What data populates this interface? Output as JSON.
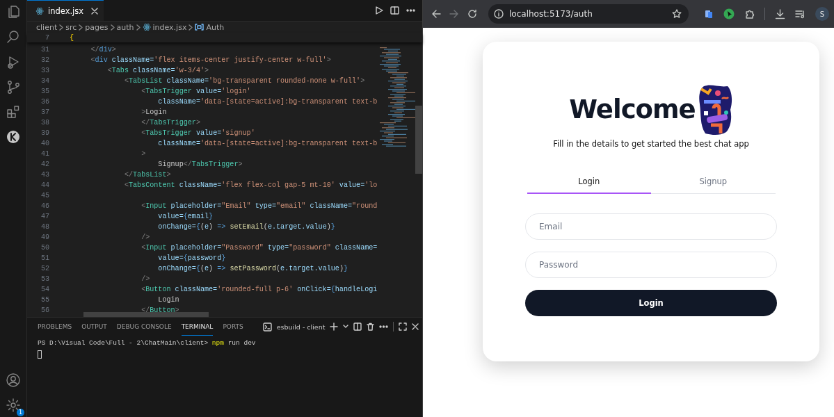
{
  "editor": {
    "settings_badge": "1",
    "tab": {
      "label": "index.jsx",
      "selected": true
    },
    "breadcrumb": [
      {
        "kind": "folder",
        "label": "client"
      },
      {
        "kind": "folder",
        "label": "src"
      },
      {
        "kind": "folder",
        "label": "pages"
      },
      {
        "kind": "folder",
        "label": "auth"
      },
      {
        "kind": "file",
        "label": "index.jsx"
      },
      {
        "kind": "symbol",
        "label": "Auth"
      }
    ],
    "sticky_line": {
      "number": "7",
      "segments": [
        {
          "kind": "bracket",
          "text": "{"
        }
      ]
    },
    "lines": [
      {
        "number": "31",
        "segments": [
          {
            "kind": "punct",
            "text": "        </"
          },
          {
            "kind": "htag",
            "text": "div"
          },
          {
            "kind": "punct",
            "text": ">"
          }
        ]
      },
      {
        "number": "32",
        "segments": [
          {
            "kind": "punct",
            "text": "        <"
          },
          {
            "kind": "htag",
            "text": "div"
          },
          {
            "kind": "attr",
            "text": " className="
          },
          {
            "kind": "str",
            "text": "'flex items-center justify-center w-full'"
          },
          {
            "kind": "punct",
            "text": ">"
          }
        ]
      },
      {
        "number": "33",
        "segments": [
          {
            "kind": "punct",
            "text": "            <"
          },
          {
            "kind": "tag",
            "text": "Tabs"
          },
          {
            "kind": "attr",
            "text": " className="
          },
          {
            "kind": "str",
            "text": "'w-3/4'"
          },
          {
            "kind": "punct",
            "text": ">"
          }
        ]
      },
      {
        "number": "34",
        "segments": [
          {
            "kind": "punct",
            "text": "                <"
          },
          {
            "kind": "tag",
            "text": "TabsList"
          },
          {
            "kind": "attr",
            "text": " className="
          },
          {
            "kind": "str",
            "text": "'bg-transparent rounded-none w-full'"
          },
          {
            "kind": "punct",
            "text": ">"
          }
        ]
      },
      {
        "number": "35",
        "segments": [
          {
            "kind": "punct",
            "text": "                    <"
          },
          {
            "kind": "tag",
            "text": "TabsTrigger"
          },
          {
            "kind": "attr",
            "text": " value="
          },
          {
            "kind": "str",
            "text": "'login'"
          }
        ]
      },
      {
        "number": "36",
        "segments": [
          {
            "kind": "attr",
            "text": "                        className="
          },
          {
            "kind": "str",
            "text": "'data-[state=active]:bg-transparent text-b"
          }
        ]
      },
      {
        "number": "37",
        "segments": [
          {
            "kind": "punct",
            "text": "                    >"
          },
          {
            "kind": "text",
            "text": "Login"
          }
        ]
      },
      {
        "number": "38",
        "segments": [
          {
            "kind": "punct",
            "text": "                    </"
          },
          {
            "kind": "tag",
            "text": "TabsTrigger"
          },
          {
            "kind": "punct",
            "text": ">"
          }
        ]
      },
      {
        "number": "39",
        "segments": [
          {
            "kind": "punct",
            "text": "                    <"
          },
          {
            "kind": "tag",
            "text": "TabsTrigger"
          },
          {
            "kind": "attr",
            "text": " value="
          },
          {
            "kind": "str",
            "text": "'signup'"
          }
        ]
      },
      {
        "number": "40",
        "segments": [
          {
            "kind": "attr",
            "text": "                        className="
          },
          {
            "kind": "str",
            "text": "'data-[state=active]:bg-transparent text-b"
          }
        ]
      },
      {
        "number": "41",
        "segments": [
          {
            "kind": "punct",
            "text": "                    >"
          }
        ]
      },
      {
        "number": "42",
        "segments": [
          {
            "kind": "text",
            "text": "                        Signup"
          },
          {
            "kind": "punct",
            "text": "</"
          },
          {
            "kind": "tag",
            "text": "TabsTrigger"
          },
          {
            "kind": "punct",
            "text": ">"
          }
        ]
      },
      {
        "number": "43",
        "segments": [
          {
            "kind": "punct",
            "text": "                </"
          },
          {
            "kind": "tag",
            "text": "TabsList"
          },
          {
            "kind": "punct",
            "text": ">"
          }
        ]
      },
      {
        "number": "44",
        "segments": [
          {
            "kind": "punct",
            "text": "                <"
          },
          {
            "kind": "tag",
            "text": "TabsContent"
          },
          {
            "kind": "attr",
            "text": " className="
          },
          {
            "kind": "str",
            "text": "'flex flex-col gap-5 mt-10'"
          },
          {
            "kind": "attr",
            "text": " value="
          },
          {
            "kind": "str",
            "text": "'lo"
          }
        ]
      },
      {
        "number": "45"
      },
      {
        "number": "46",
        "segments": [
          {
            "kind": "punct",
            "text": "                    <"
          },
          {
            "kind": "tag",
            "text": "Input"
          },
          {
            "kind": "attr",
            "text": " placeholder="
          },
          {
            "kind": "str",
            "text": "\"Email\""
          },
          {
            "kind": "attr",
            "text": " type="
          },
          {
            "kind": "str",
            "text": "\"email\""
          },
          {
            "kind": "attr",
            "text": " className="
          },
          {
            "kind": "str",
            "text": "\"round"
          }
        ]
      },
      {
        "number": "47",
        "segments": [
          {
            "kind": "attr",
            "text": "                        value="
          },
          {
            "kind": "brace",
            "text": "{"
          },
          {
            "kind": "var",
            "text": "email"
          },
          {
            "kind": "brace",
            "text": "}"
          }
        ]
      },
      {
        "number": "48",
        "segments": [
          {
            "kind": "attr",
            "text": "                        onChange="
          },
          {
            "kind": "brace",
            "text": "{"
          },
          {
            "kind": "text",
            "text": "("
          },
          {
            "kind": "var",
            "text": "e"
          },
          {
            "kind": "text",
            "text": ") "
          },
          {
            "kind": "brace",
            "text": "=>"
          },
          {
            "kind": "fn",
            "text": " setEmail"
          },
          {
            "kind": "text",
            "text": "("
          },
          {
            "kind": "var",
            "text": "e.target.value"
          },
          {
            "kind": "text",
            "text": ")"
          },
          {
            "kind": "brace",
            "text": "}"
          }
        ]
      },
      {
        "number": "49",
        "segments": [
          {
            "kind": "punct",
            "text": "                    />"
          }
        ]
      },
      {
        "number": "50",
        "segments": [
          {
            "kind": "punct",
            "text": "                    <"
          },
          {
            "kind": "tag",
            "text": "Input"
          },
          {
            "kind": "attr",
            "text": " placeholder="
          },
          {
            "kind": "str",
            "text": "\"Password\""
          },
          {
            "kind": "attr",
            "text": " type="
          },
          {
            "kind": "str",
            "text": "\"password\""
          },
          {
            "kind": "attr",
            "text": " className="
          }
        ]
      },
      {
        "number": "51",
        "segments": [
          {
            "kind": "attr",
            "text": "                        value="
          },
          {
            "kind": "brace",
            "text": "{"
          },
          {
            "kind": "var",
            "text": "password"
          },
          {
            "kind": "brace",
            "text": "}"
          }
        ]
      },
      {
        "number": "52",
        "segments": [
          {
            "kind": "attr",
            "text": "                        onChange="
          },
          {
            "kind": "brace",
            "text": "{"
          },
          {
            "kind": "text",
            "text": "("
          },
          {
            "kind": "var",
            "text": "e"
          },
          {
            "kind": "text",
            "text": ") "
          },
          {
            "kind": "brace",
            "text": "=>"
          },
          {
            "kind": "fn",
            "text": " setPassword"
          },
          {
            "kind": "text",
            "text": "("
          },
          {
            "kind": "var",
            "text": "e.target.value"
          },
          {
            "kind": "text",
            "text": ")"
          },
          {
            "kind": "brace",
            "text": "}"
          }
        ]
      },
      {
        "number": "53",
        "segments": [
          {
            "kind": "punct",
            "text": "                    />"
          }
        ]
      },
      {
        "number": "54",
        "segments": [
          {
            "kind": "punct",
            "text": "                    <"
          },
          {
            "kind": "tag",
            "text": "Button"
          },
          {
            "kind": "attr",
            "text": " className="
          },
          {
            "kind": "str",
            "text": "'rounded-full p-6'"
          },
          {
            "kind": "attr",
            "text": " onClick="
          },
          {
            "kind": "brace",
            "text": "{"
          },
          {
            "kind": "var",
            "text": "handleLogi"
          }
        ]
      },
      {
        "number": "55",
        "segments": [
          {
            "kind": "text",
            "text": "                        Login"
          }
        ]
      },
      {
        "number": "56",
        "segments": [
          {
            "kind": "punct",
            "text": "                    </"
          },
          {
            "kind": "tag",
            "text": "Button"
          },
          {
            "kind": "punct",
            "text": ">"
          }
        ]
      }
    ]
  },
  "panel": {
    "tabs": [
      {
        "label": "PROBLEMS",
        "selected": false
      },
      {
        "label": "OUTPUT",
        "selected": false
      },
      {
        "label": "DEBUG CONSOLE",
        "selected": false
      },
      {
        "label": "TERMINAL",
        "selected": true
      },
      {
        "label": "PORTS",
        "selected": false
      }
    ],
    "terminal_name": "esbuild - client",
    "prompt": [
      {
        "kind": "plain",
        "text": "PS D:\\Visual Code\\Full - 2\\ChatMain\\client> "
      },
      {
        "kind": "command",
        "text": "npm"
      },
      {
        "kind": "plain",
        "text": " run dev"
      }
    ]
  },
  "browser": {
    "url": "localhost:5173/auth",
    "profile_initial": "S",
    "page": {
      "title": "Welcome",
      "subtitle": "Fill in the details to get started the best chat app",
      "tabs": [
        {
          "label": "Login",
          "selected": true
        },
        {
          "label": "Signup",
          "selected": false
        }
      ],
      "fields": [
        {
          "placeholder": "Email"
        },
        {
          "placeholder": "Password"
        }
      ],
      "submit": "Login"
    }
  }
}
